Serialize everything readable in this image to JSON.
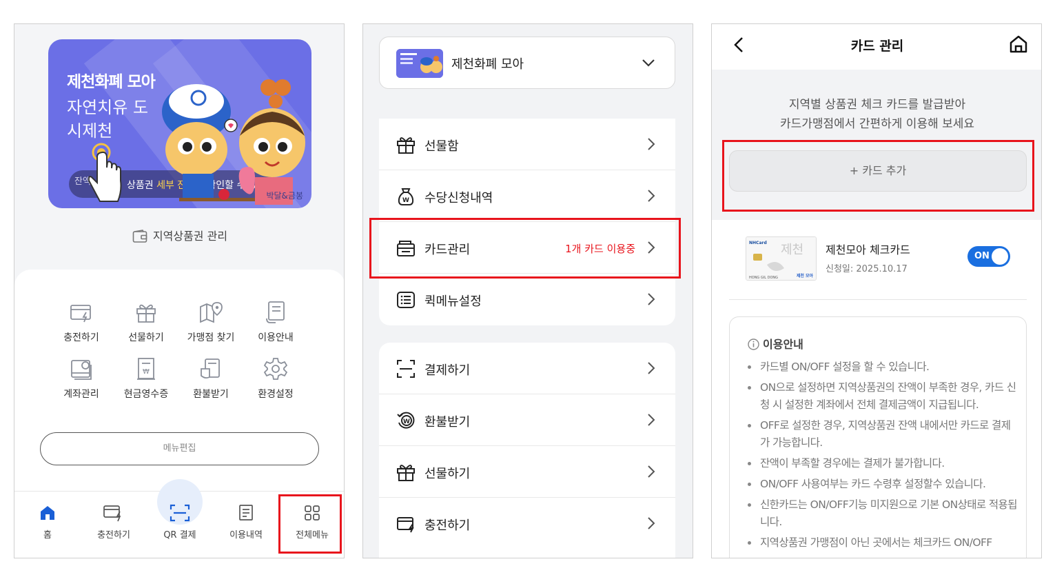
{
  "panel1": {
    "banner": {
      "title": "제천화폐 모아",
      "slogan": "자연치유 도시제천",
      "pill_prefix": "잔액",
      "pill_text_before": "상품권 ",
      "pill_highlight": "세부 잔액",
      "pill_text_after": "을 확인할 수 있어요.",
      "credit": "박달&금봉"
    },
    "region_mgmt_label": "지역상품권 관리",
    "menu_items": [
      {
        "label": "충전하기",
        "icon": "charge-card-icon"
      },
      {
        "label": "선물하기",
        "icon": "gift-icon"
      },
      {
        "label": "가맹점 찾기",
        "icon": "map-pin-icon"
      },
      {
        "label": "이용안내",
        "icon": "guide-document-icon"
      },
      {
        "label": "계좌관리",
        "icon": "account-icon"
      },
      {
        "label": "현금영수증",
        "icon": "receipt-icon"
      },
      {
        "label": "환불받기",
        "icon": "refund-icon"
      },
      {
        "label": "환경설정",
        "icon": "gear-icon"
      }
    ],
    "menu_edit_label": "메뉴편집",
    "bottom_nav": [
      {
        "label": "홈",
        "icon": "home-icon"
      },
      {
        "label": "충전하기",
        "icon": "charge-card-icon"
      },
      {
        "label": "QR 결제",
        "icon": "qr-scan-icon"
      },
      {
        "label": "이용내역",
        "icon": "history-icon"
      },
      {
        "label": "전체메뉴",
        "icon": "grid-menu-icon"
      }
    ],
    "accent_color": "#6b6fe6",
    "highlight_color": "#e8141c"
  },
  "panel2": {
    "selector_title": "제천화폐 모아",
    "group1": [
      {
        "label": "선물함",
        "icon": "gift-box-icon",
        "status": ""
      },
      {
        "label": "수당신청내역",
        "icon": "money-bag-icon",
        "status": ""
      },
      {
        "label": "카드관리",
        "icon": "wallet-card-icon",
        "status": "1개 카드 이용중"
      },
      {
        "label": "퀵메뉴설정",
        "icon": "list-icon",
        "status": ""
      }
    ],
    "group2": [
      {
        "label": "결제하기",
        "icon": "scan-frame-icon"
      },
      {
        "label": "환불받기",
        "icon": "refund-circle-icon"
      },
      {
        "label": "선물하기",
        "icon": "gift-icon"
      },
      {
        "label": "충전하기",
        "icon": "charge-card-icon"
      }
    ]
  },
  "panel3": {
    "title": "카드 관리",
    "message_line1": "지역별 상품권 체크 카드를 발급받아",
    "message_line2": "카드가맹점에서 간편하게 이용해 보세요",
    "add_card_label": "+ 카드 추가",
    "card": {
      "name": "제천모아 체크카드",
      "date": "신청일: 2025.10.17",
      "toggle_label": "ON",
      "toggle_on": true,
      "card_brand": "NHCard",
      "card_holder": "HONG GIL DONG",
      "card_logo": "제천 모아",
      "card_watermark": "제천"
    },
    "info_title": "이용안내",
    "info_items": [
      "카드별 ON/OFF 설정을 할 수 있습니다.",
      "ON으로 설정하면 지역상품권의 잔액이 부족한 경우, 카드 신청 시 설정한 계좌에서 전체 결제금액이 지급됩니다.",
      "OFF로 설정한 경우, 지역상품권 잔액 내에서만 카드로 결제가 가능합니다.",
      "잔액이 부족할 경우에는 결제가 불가합니다.",
      "ON/OFF 사용여부는 카드 수령후 설정할수 있습니다.",
      "신한카드는 ON/OFF기능 미지원으로 기본 ON상태로 적용됩니다.",
      "지역상품권 가맹점이 아닌 곳에서는 체크카드 ON/OFF"
    ]
  }
}
